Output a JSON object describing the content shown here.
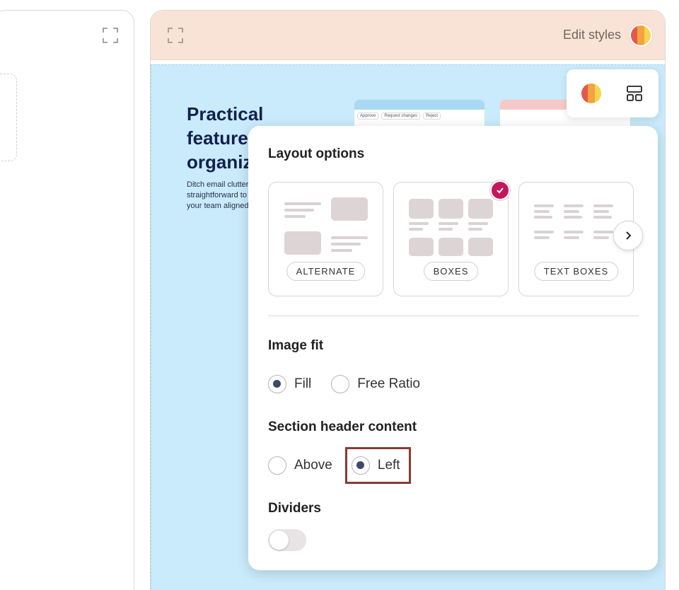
{
  "header": {
    "edit_styles_label": "Edit styles"
  },
  "palette_colors": [
    "#e5574b",
    "#f3a341",
    "#f7d451"
  ],
  "canvas_preview": {
    "title_lines": [
      "Practical",
      "features",
      "organiz"
    ],
    "description_lines": [
      "Ditch email clutter",
      "straightforward to",
      "your team aligned"
    ],
    "mini_chips": [
      "Approve",
      "Request changes",
      "Reject"
    ]
  },
  "popup": {
    "layout_options_title": "Layout options",
    "layouts": [
      {
        "label": "ALTERNATE",
        "selected": false
      },
      {
        "label": "BOXES",
        "selected": true
      },
      {
        "label": "TEXT BOXES",
        "selected": false
      }
    ],
    "image_fit_title": "Image fit",
    "image_fit_options": [
      {
        "label": "Fill",
        "selected": true
      },
      {
        "label": "Free Ratio",
        "selected": false
      }
    ],
    "section_header_title": "Section header content",
    "section_header_options": [
      {
        "label": "Above",
        "selected": false
      },
      {
        "label": "Left",
        "selected": true
      }
    ],
    "dividers_title": "Dividers",
    "dividers_on": false
  },
  "colors": {
    "accent_check": "#c2185b",
    "radio_dot": "#3b4a6b",
    "canvas_bg": "#c9ebfb",
    "header_bg": "#f9e3d6",
    "highlight_border": "#8a3a36"
  }
}
